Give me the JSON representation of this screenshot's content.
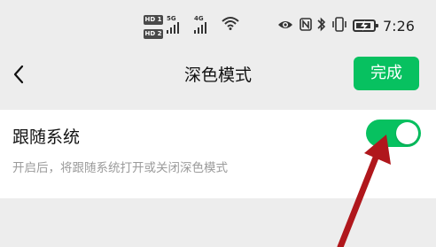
{
  "status_bar": {
    "hd1": "HD 1",
    "hd2": "HD 2",
    "net1": "5G",
    "net2": "4G",
    "time": "7:26",
    "icons": [
      "hd-icon",
      "signal-icon",
      "wifi-icon",
      "eye-icon",
      "nfc-icon",
      "bluetooth-icon",
      "vibrate-icon",
      "battery-charging-icon"
    ]
  },
  "nav": {
    "title": "深色模式",
    "done_label": "完成",
    "accent": "#07c160"
  },
  "setting": {
    "label": "跟随系统",
    "description": "开启后，将跟随系统打开或关闭深色模式",
    "enabled": true,
    "toggle_color": "#07c160"
  },
  "annotation": {
    "arrow_color": "#b0171c"
  }
}
